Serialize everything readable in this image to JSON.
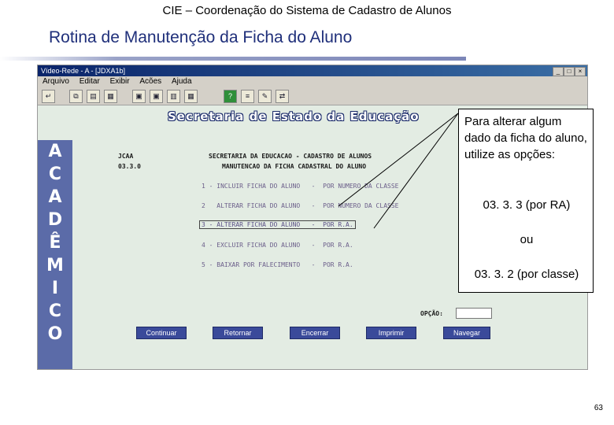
{
  "header": {
    "title": "CIE – Coordenação do Sistema de Cadastro de Alunos"
  },
  "slide": {
    "title": "Rotina de Manutenção da Ficha do Aluno",
    "page_number": "63"
  },
  "window": {
    "titlebar_text": "Vídeo-Rede - A - [JDXA1b]",
    "menu": [
      "Arquivo",
      "Editar",
      "Exibir",
      "Acões",
      "Ajuda"
    ],
    "banner": "Secretaria de Estado da Educação",
    "sidebar_letters": [
      "A",
      "C",
      "A",
      "D",
      "Ê",
      "M",
      "I",
      "C",
      "O"
    ],
    "left_code": "JCAA",
    "left_number": "03.3.0",
    "screen_title_1": "SECRETARIA DA EDUCACAO - CADASTRO DE ALUNOS",
    "screen_title_2": "MANUTENCAO DA FICHA CADASTRAL DO ALUNO",
    "menu_lines": [
      "1 - INCLUIR FICHA DO ALUNO   -  POR NUMERO DA CLASSE",
      "2   ALTERAR FICHA DO ALUNO   -  POR NUMERO DA CLASSE",
      "3 - ALTERAR FICHA DO ALUNO   -  POR R.A.",
      "4 - EXCLUIR FICHA DO ALUNO   -  POR R.A.",
      "5 - BAIXAR POR FALECIMENTO   -  POR R.A."
    ],
    "option_label": "OPÇÃO:",
    "option_value": "",
    "buttons": {
      "continue": "Continuar",
      "return": "Retornar",
      "close": "Encerrar",
      "print": "Imprimir",
      "navigate": "Navegar"
    }
  },
  "callout": {
    "text": "Para alterar algum dado da ficha do aluno, utilize as opções:",
    "option_1": "03. 3. 3 (por RA)",
    "or": "ou",
    "option_2": "03. 3. 2 (por classe)"
  },
  "colors": {
    "title_blue": "#1f2f7a",
    "sidebar": "#5b6ba8",
    "button": "#3a4a9a",
    "window_bg": "#e3ece3"
  }
}
